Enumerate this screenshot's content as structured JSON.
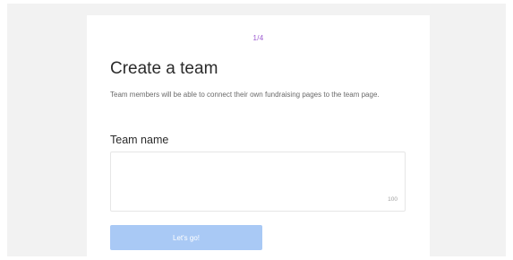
{
  "step_indicator": "1/4",
  "title": "Create a team",
  "description": "Team members will be able to connect their own fundraising pages to the team page.",
  "team_name": {
    "label": "Team name",
    "value": "",
    "char_limit": "100"
  },
  "submit_button": {
    "label": "Let's go!",
    "color": "#a9c9f5"
  },
  "accent_color": "#9b59d0"
}
